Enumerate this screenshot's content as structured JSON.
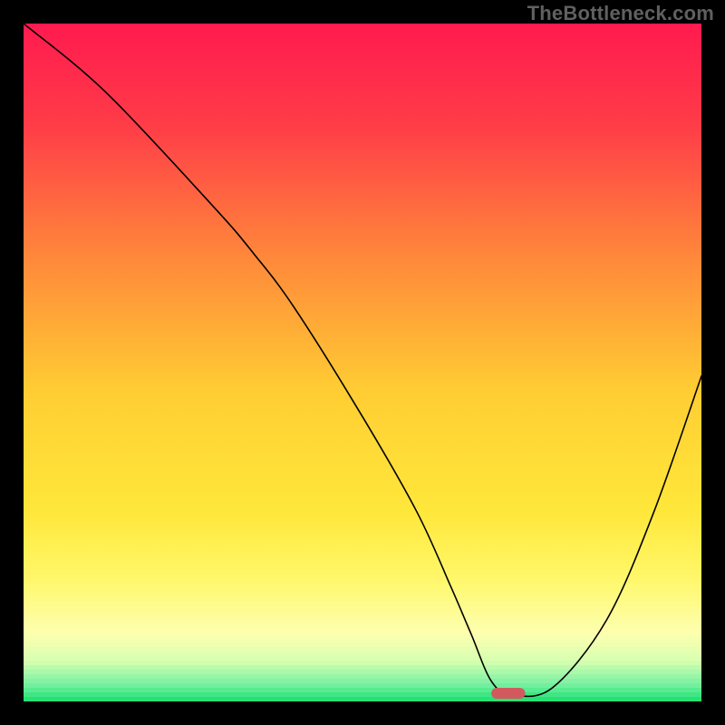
{
  "watermark": {
    "text": "TheBottleneck.com"
  },
  "chart_data": {
    "type": "line",
    "title": "",
    "xlabel": "",
    "ylabel": "",
    "xlim": [
      0,
      100
    ],
    "ylim": [
      0,
      100
    ],
    "x": [
      0,
      12,
      28,
      34,
      40,
      50,
      58,
      63,
      66,
      69,
      72,
      78,
      86,
      93,
      100
    ],
    "values": [
      100,
      90,
      73,
      66,
      58,
      42,
      28,
      17,
      10,
      3,
      1,
      2,
      12,
      28,
      48
    ],
    "minimum_marker": {
      "x_center": 71.5,
      "y_center": 1.2,
      "width": 5,
      "height": 1.6,
      "color": "#d25a5f"
    },
    "gradient_stops": [
      {
        "pos": 0.0,
        "color": "#ff1a4f"
      },
      {
        "pos": 0.15,
        "color": "#ff3c48"
      },
      {
        "pos": 0.35,
        "color": "#ff8a3a"
      },
      {
        "pos": 0.55,
        "color": "#ffcf33"
      },
      {
        "pos": 0.72,
        "color": "#ffe73a"
      },
      {
        "pos": 0.82,
        "color": "#fff86b"
      },
      {
        "pos": 0.9,
        "color": "#fdffb0"
      },
      {
        "pos": 0.94,
        "color": "#d8ffb0"
      },
      {
        "pos": 0.975,
        "color": "#77f0a2"
      },
      {
        "pos": 1.0,
        "color": "#19e06e"
      }
    ]
  }
}
